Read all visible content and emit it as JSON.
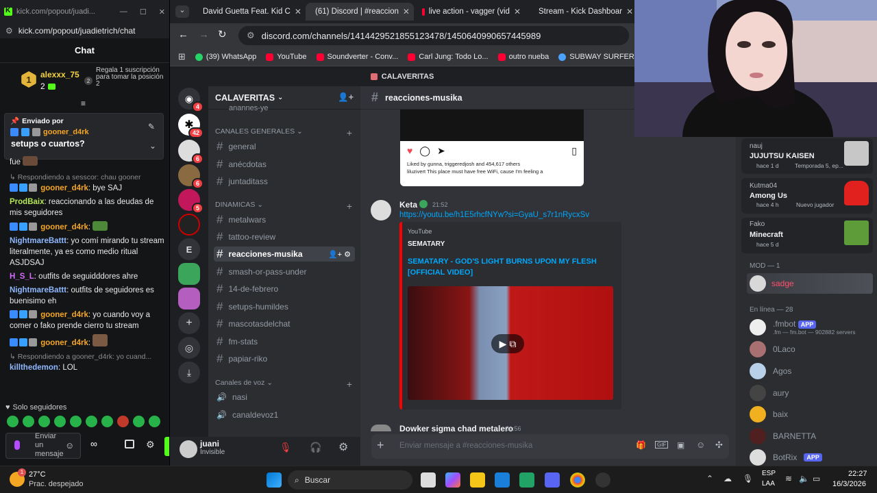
{
  "kick": {
    "window_title": "kick.com/popout/juadi...",
    "url": "kick.com/popout/juadietrich/chat",
    "chat_title": "Chat",
    "top_user": {
      "name": "alexxx_75",
      "rank": "1",
      "subs": "2"
    },
    "promo_rank": "2",
    "promo_text": "Regala 1 suscripción para tomar la posición 2",
    "pinned": {
      "header": "Enviado por",
      "user": "gooner_d4rk",
      "text": "setups o cuartos?"
    },
    "messages": [
      {
        "reply": "",
        "user": "",
        "text": "fue",
        "color": "#e9e9e9"
      },
      {
        "reply": "Respondiendo a sesscor: chau gooner",
        "user": "gooner_d4rk",
        "text": ": bye SAJ",
        "color": "#f5a623"
      },
      {
        "reply": "",
        "user": "ProdBaix",
        "text": ": reaccionando a las deudas de mis seguidores",
        "color": "#b5e853"
      },
      {
        "reply": "",
        "user": "gooner_d4rk",
        "text": ":",
        "color": "#f5a623"
      },
      {
        "reply": "",
        "user": "NightmareBattt",
        "text": ": yo comí mirando tu stream literalmente, ya es como medio ritual ASJDSAJ",
        "color": "#8fb8ff"
      },
      {
        "reply": "",
        "user": "H_S_L",
        "text": ": outfits de seguidddores ahre",
        "color": "#d66bff"
      },
      {
        "reply": "",
        "user": "NightmareBattt",
        "text": ": outfits de seguidores es buenisimo eh",
        "color": "#8fb8ff"
      },
      {
        "reply": "",
        "user": "gooner_d4rk",
        "text": ": yo cuando voy a comer o fako prende cierro tu stream",
        "color": "#f5a623"
      },
      {
        "reply": "",
        "user": "gooner_d4rk",
        "text": ":",
        "color": "#f5a623"
      },
      {
        "reply": "Respondiendo a gooner_d4rk: yo cuand...",
        "user": "killthedemon",
        "text": ": LOL",
        "color": "#8fb8ff"
      }
    ],
    "followers_only": "Solo seguidores",
    "input_placeholder": "Enviar un mensaje"
  },
  "browser": {
    "tabs": [
      {
        "label": "David Guetta Feat. Kid C",
        "icon_color": "#ff0033",
        "active": false
      },
      {
        "label": "(61) Discord | #reaccion",
        "icon_color": "#5865f2",
        "active": true
      },
      {
        "label": "live action - vagger (vid",
        "icon_color": "#ff0033",
        "active": false
      },
      {
        "label": "Stream - Kick Dashboar",
        "icon_color": "#53fc18",
        "active": false
      }
    ],
    "discord_badge": "61",
    "url": "discord.com/channels/1414429521855123478/1450640990657445989",
    "bookmarks": [
      {
        "label": "(39) WhatsApp",
        "color": "#25d366"
      },
      {
        "label": "YouTube",
        "color": "#ff0033"
      },
      {
        "label": "Soundverter - Conv...",
        "color": "#ff0033"
      },
      {
        "label": "Carl Jung: Todo Lo...",
        "color": "#ff0033"
      },
      {
        "label": "outro nueba",
        "color": "#ff0033"
      },
      {
        "label": "SUBWAY SURFERS -...",
        "color": "#4aa3ff"
      }
    ]
  },
  "discord": {
    "top_server_label": "CALAVERITAS",
    "server_name": "CALAVERITAS",
    "guild_badges": [
      "4",
      "42",
      "6",
      "6",
      "5"
    ],
    "guild_letter": "E",
    "cut_channel": "anannes-ye",
    "categories": [
      "CANALES GENERALES",
      "DINAMICAS",
      "Canales de voz"
    ],
    "channels_general": [
      "general",
      "anécdotas",
      "juntaditass"
    ],
    "channels_dinamicas": [
      "metalwars",
      "tattoo-review",
      "reacciones-musika",
      "smash-or-pass-under",
      "14-de-febrero",
      "setups-humildes",
      "mascotasdelchat",
      "fm-stats",
      "papiar-riko"
    ],
    "voice_channels": [
      "nasi",
      "canaldevoz1"
    ],
    "user": {
      "name": "juani",
      "status": "Invisible"
    },
    "channel_header": "reacciones-musika",
    "insta": {
      "liked_by": "Liked by gunna, triggeredjosh and 454,617 others",
      "caption": "liluzivert This place must have free WiFi, cause I'm feeling a"
    },
    "message": {
      "author": "Keta",
      "time": "21:52",
      "link": "https://youtu.be/h1E5rhcfNYw?si=GyaU_s7r1nRycxSv",
      "embed_provider": "YouTube",
      "embed_author": "SEMATARY",
      "embed_title": "SEMATARY - GOD'S LIGHT BURNS UPON MY FLESH [OFFICIAL VIDEO]"
    },
    "next_message": {
      "author": "Dowker sigma chad metalero",
      "time": "21:56"
    },
    "input_placeholder": "Enviar mensaje a #reacciones-musika",
    "activities": [
      {
        "user": "nauj",
        "title": "JUJUTSU KAISEN",
        "detail": "hace 1 d",
        "extra": "Temporada 5, ep...",
        "color": "#c7c7c7"
      },
      {
        "user": "Kutma04",
        "title": "Among Us",
        "detail": "hace 4 h",
        "extra": "Nuevo jugador",
        "color": "#e0211e"
      },
      {
        "user": "Fako",
        "title": "Minecraft",
        "detail": "hace 5 d",
        "extra": "",
        "color": "#5e9c3a"
      }
    ],
    "mod_header": "MOD — 1",
    "mod_name": "sadge",
    "online_header": "En línea — 28",
    "members": [
      {
        "name": ".fmbot",
        "app": "APP",
        "sub": ".fm — fm.bot — 902882 servers"
      },
      {
        "name": "0Laco",
        "app": "",
        "sub": ""
      },
      {
        "name": "Agos",
        "app": "",
        "sub": ""
      },
      {
        "name": "aury",
        "app": "",
        "sub": ""
      },
      {
        "name": "baix",
        "app": "",
        "sub": ""
      },
      {
        "name": "BARNETTA",
        "app": "",
        "sub": ""
      },
      {
        "name": "BotRix",
        "app": "APP",
        "sub": ""
      }
    ]
  },
  "taskbar": {
    "weather_temp": "27°C",
    "weather_desc": "Prac. despejado",
    "weather_badge": "1",
    "search": "Buscar",
    "lang_top": "ESP",
    "lang_bottom": "LAA",
    "time": "22:27",
    "date": "16/3/2026"
  }
}
